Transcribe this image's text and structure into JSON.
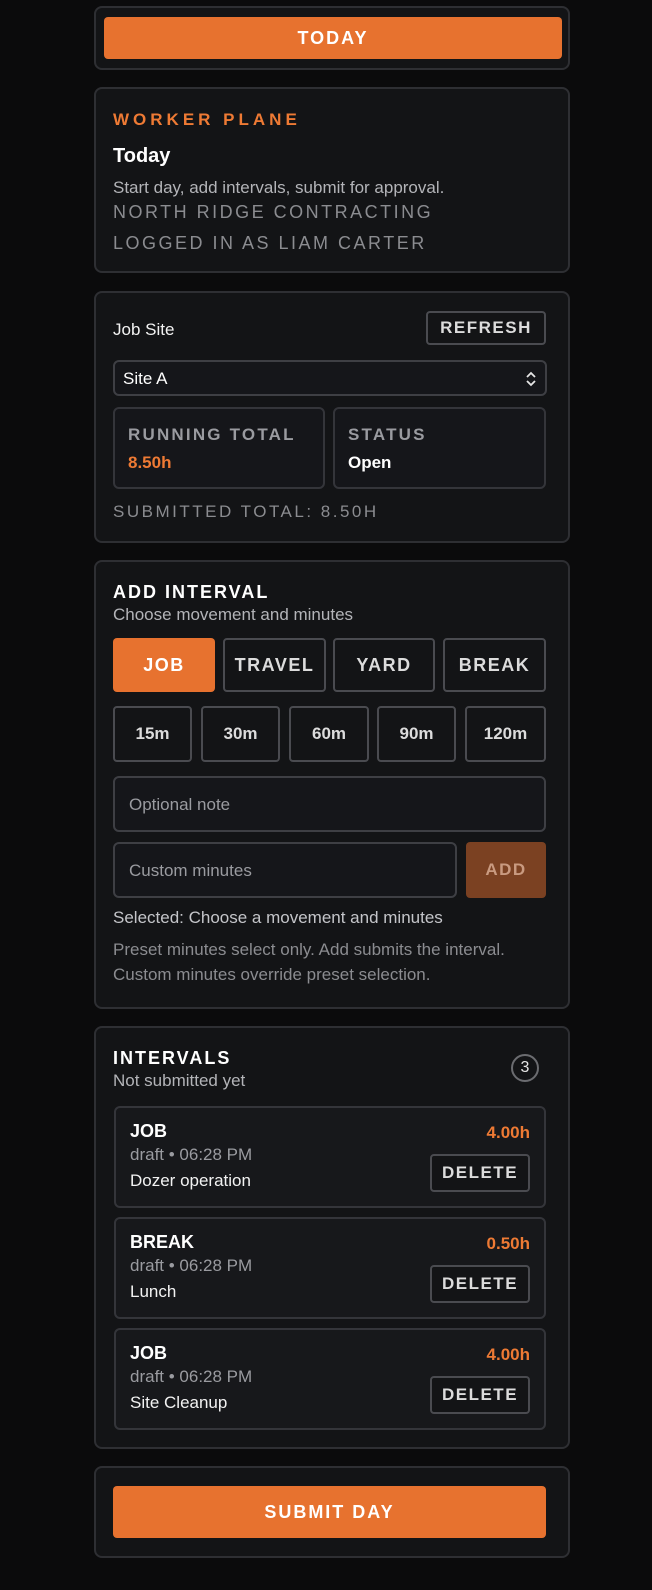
{
  "top": {
    "today_label": "TODAY"
  },
  "header": {
    "eyebrow": "WORKER PLANE",
    "title": "Today",
    "subtitle": "Start day, add intervals, submit for approval.",
    "company": "NORTH RIDGE CONTRACTING",
    "logged_in": "LOGGED IN AS LIAM CARTER"
  },
  "jobsite": {
    "label": "Job Site",
    "refresh_label": "REFRESH",
    "selected_site": "Site A",
    "running_total_label": "RUNNING TOTAL",
    "running_total_value": "8.50h",
    "status_label": "STATUS",
    "status_value": "Open",
    "submitted_total": "SUBMITTED TOTAL: 8.50H"
  },
  "add_interval": {
    "title": "ADD INTERVAL",
    "subtitle": "Choose movement and minutes",
    "movements": [
      "JOB",
      "TRAVEL",
      "YARD",
      "BREAK"
    ],
    "active_movement": "JOB",
    "minutes": [
      "15m",
      "30m",
      "60m",
      "90m",
      "120m"
    ],
    "note_placeholder": "Optional note",
    "custom_placeholder": "Custom minutes",
    "add_label": "ADD",
    "selected_text": "Selected: Choose a movement and minutes",
    "help_line1": "Preset minutes select only. Add submits the interval.",
    "help_line2": "Custom minutes override preset selection."
  },
  "intervals": {
    "title": "INTERVALS",
    "subtitle": "Not submitted yet",
    "count": "3",
    "delete_label": "DELETE",
    "items": [
      {
        "kind": "JOB",
        "meta": "draft • 06:28 PM",
        "note": "Dozer operation",
        "hours": "4.00h"
      },
      {
        "kind": "BREAK",
        "meta": "draft • 06:28 PM",
        "note": "Lunch",
        "hours": "0.50h"
      },
      {
        "kind": "JOB",
        "meta": "draft • 06:28 PM",
        "note": "Site Cleanup",
        "hours": "4.00h"
      }
    ]
  },
  "footer": {
    "submit_label": "SUBMIT DAY"
  },
  "colors": {
    "accent": "#e7722f",
    "background": "#0b0b0c",
    "card": "#131416",
    "border": "#2e2f33"
  }
}
